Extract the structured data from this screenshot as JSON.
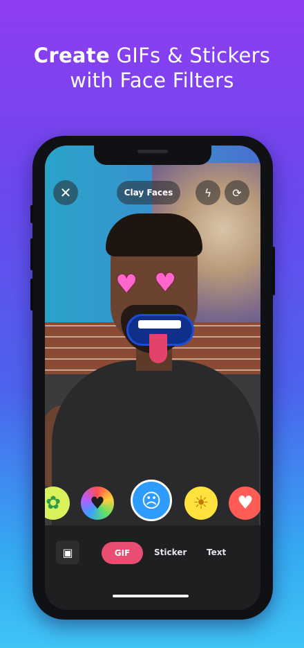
{
  "headline": {
    "bold": "Create",
    "rest_line1": " GIFs & Stickers",
    "line2": "with Face Filters"
  },
  "camera": {
    "close_icon": "close-icon",
    "title": "Clay Faces",
    "flash_icon": "flash-off-icon",
    "flip_icon": "camera-flip-icon"
  },
  "filters": [
    {
      "name": "plant-face",
      "glyph": "🌿",
      "bg": "#d9f15a"
    },
    {
      "name": "rainbow-heart",
      "glyph": "💚",
      "bg": "#ff4fa5"
    },
    {
      "name": "blue-screaming-face",
      "glyph": "😱",
      "bg": "#2e9bff",
      "selected": true
    },
    {
      "name": "sun-face",
      "glyph": "☀",
      "bg": "#ffe23d"
    },
    {
      "name": "heart-face",
      "glyph": "♥",
      "bg": "#ff5c55"
    }
  ],
  "bottom_bar": {
    "gallery_icon": "gallery-icon",
    "modes": [
      "GIF",
      "Sticker",
      "Text"
    ],
    "active_mode": "GIF"
  }
}
